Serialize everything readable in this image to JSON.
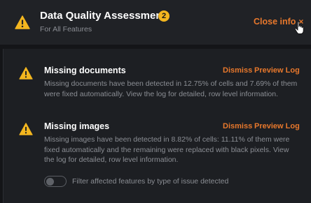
{
  "header": {
    "title": "Data Quality Assessment",
    "badge_count": "2",
    "subtitle": "For All Features",
    "close_label": "Close info",
    "close_glyph": "×"
  },
  "colors": {
    "accent": "#e8782c",
    "warning": "#f3b61f",
    "background": "#141518",
    "header_background": "#202226",
    "panel_background": "#1d1f23",
    "muted_text": "#8b8e94"
  },
  "icons": {
    "warning": "warning-triangle-icon",
    "close": "close-icon",
    "cursor": "hand-pointer-cursor-icon"
  },
  "issues": [
    {
      "title": "Missing documents",
      "description": "Missing documents have been detected in 12.75% of cells and 7.69% of them were fixed automatically. View the log for detailed, row level information.",
      "dismiss_label": "Dismiss",
      "preview_label": "Preview Log"
    },
    {
      "title": "Missing images",
      "description": "Missing images have been detected in 8.82% of cells: 11.11% of them were fixed automatically and the remaining were replaced with black pixels. View the log for detailed, row level information.",
      "dismiss_label": "Dismiss",
      "preview_label": "Preview Log"
    }
  ],
  "filter": {
    "label": "Filter affected features by type of issue detected",
    "enabled": false
  }
}
